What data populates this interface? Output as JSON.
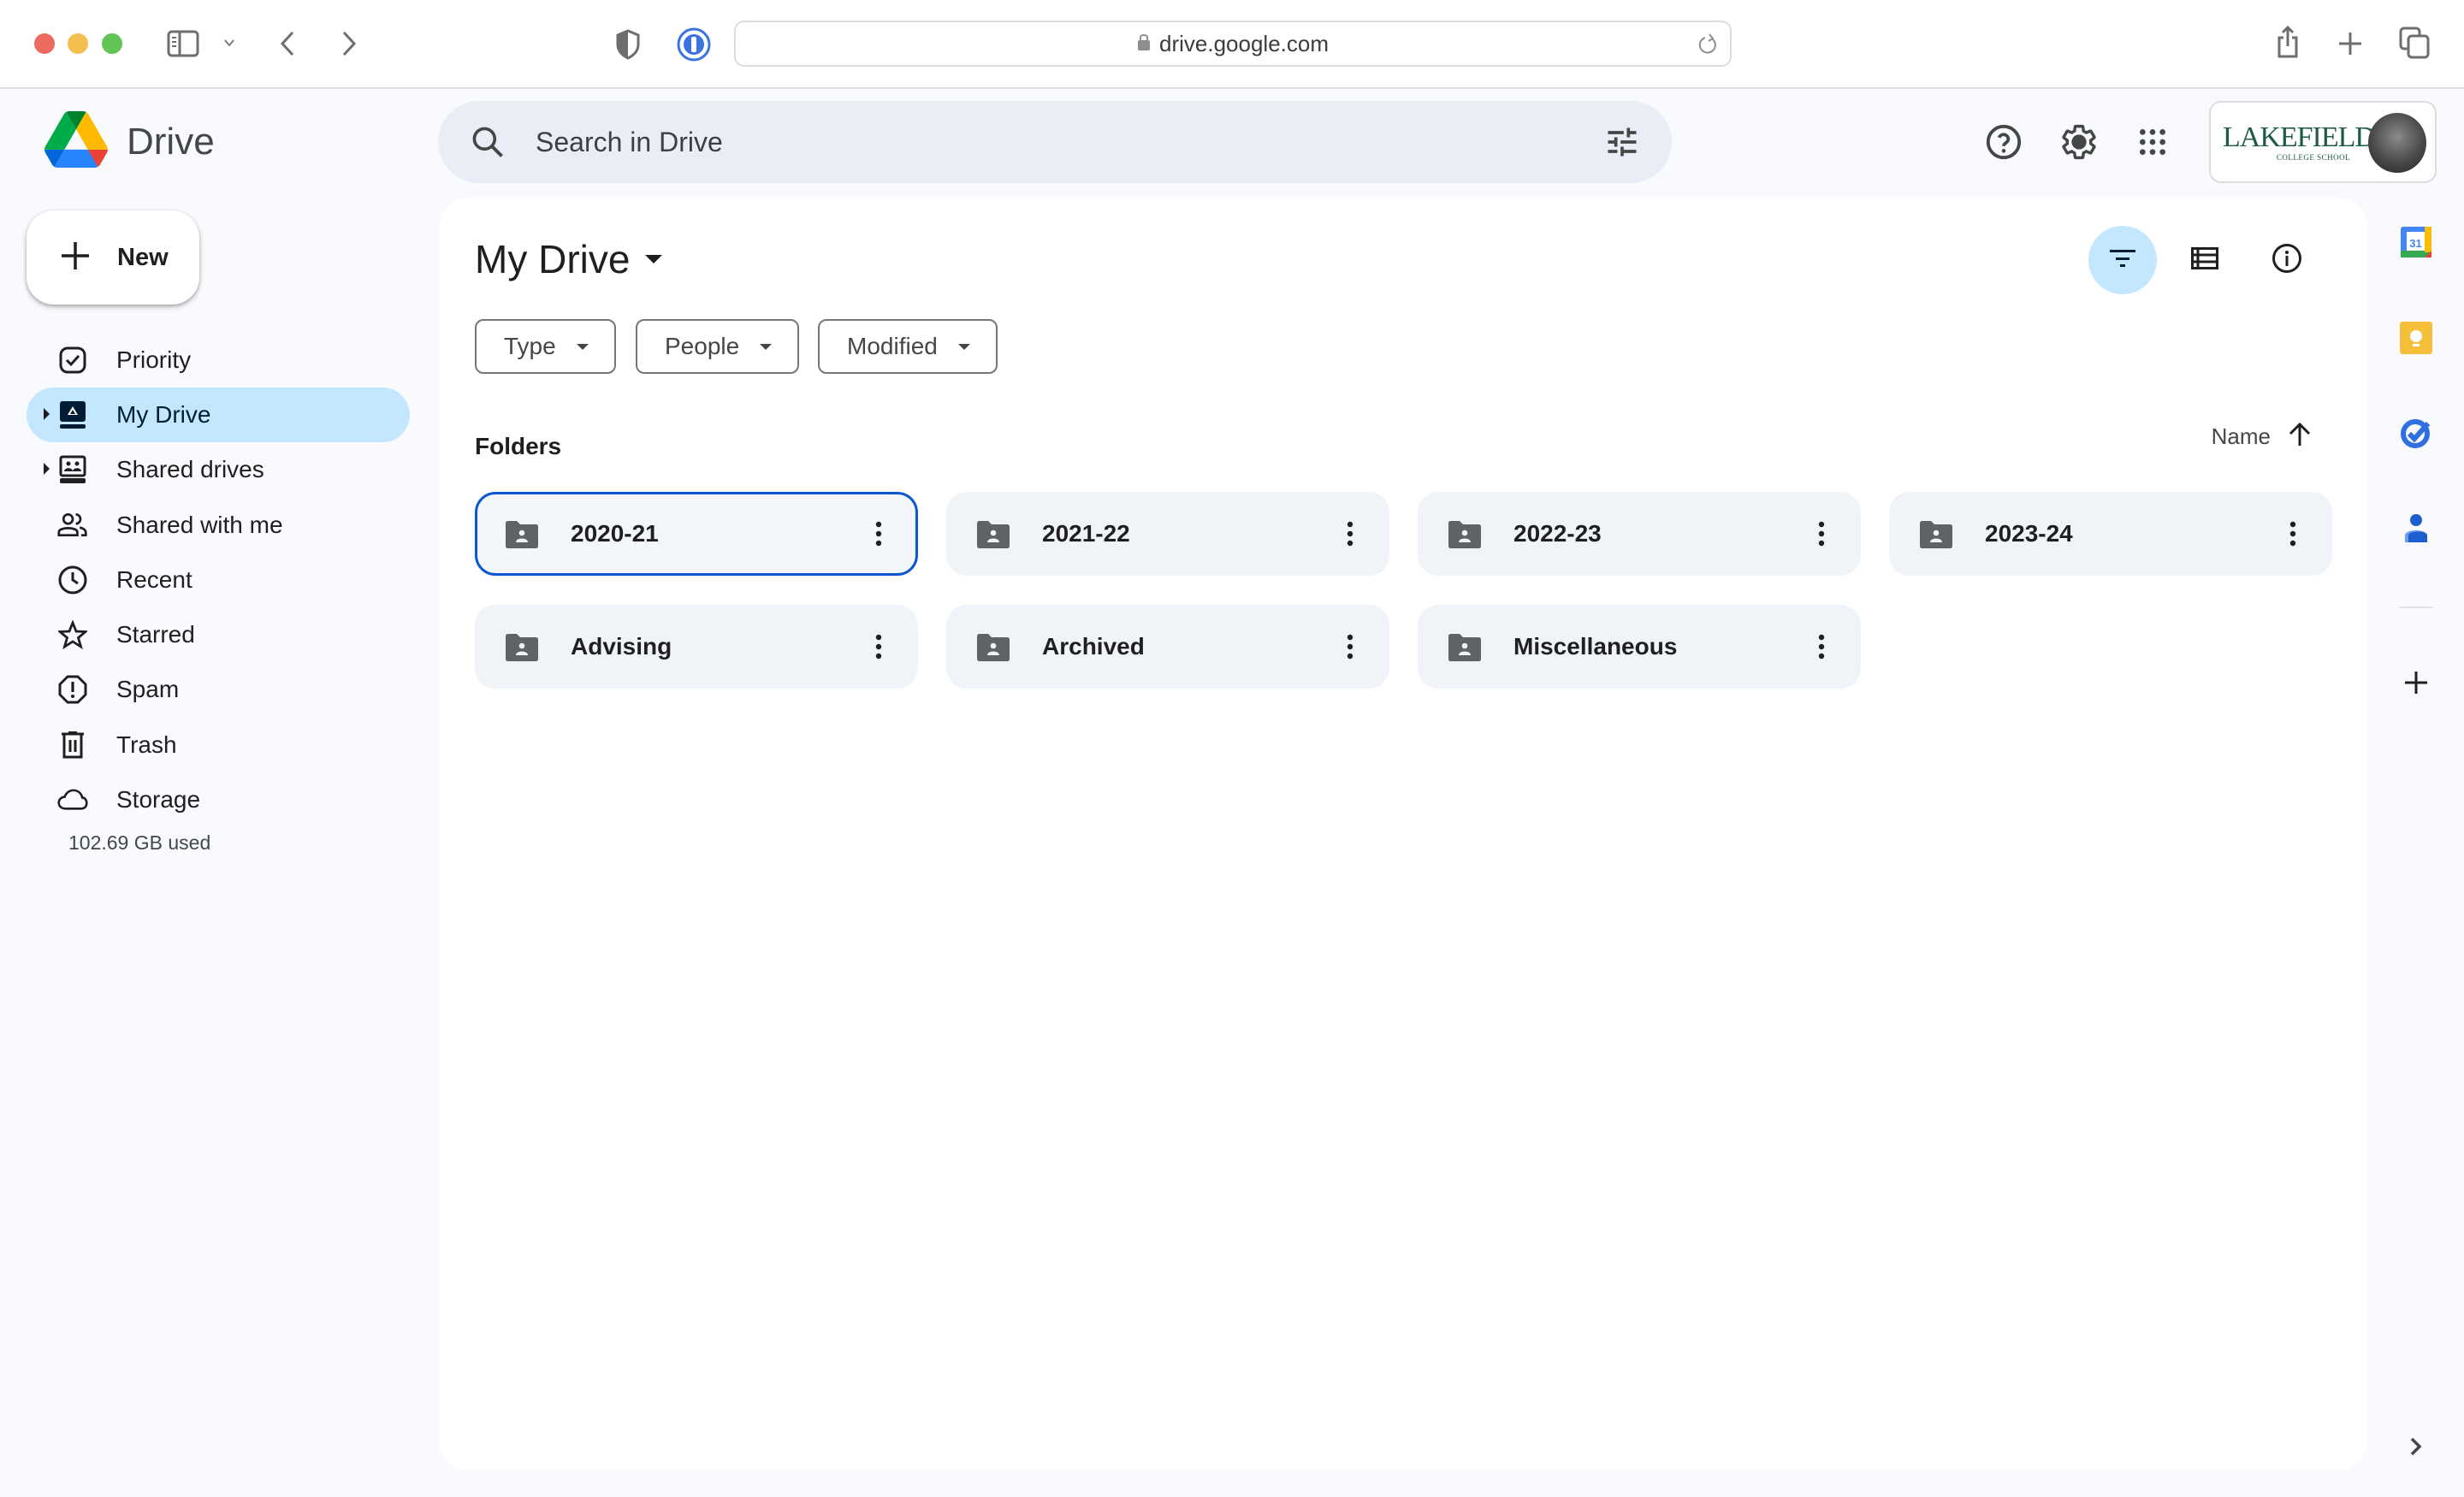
{
  "browser": {
    "url": "drive.google.com",
    "icons": [
      "sidebar-toggle-icon",
      "chevron-down-icon",
      "back-icon",
      "forward-icon",
      "shield-icon",
      "password-manager-icon",
      "lock-icon",
      "reload-icon",
      "share-icon",
      "new-tab-icon",
      "tab-overview-icon"
    ]
  },
  "app": {
    "name": "Drive",
    "search": {
      "placeholder": "Search in Drive",
      "value": ""
    },
    "header_icons": [
      "help-icon",
      "settings-icon",
      "apps-grid-icon"
    ],
    "account": {
      "org_name": "LAKEFIELD",
      "org_subtitle": "COLLEGE SCHOOL"
    }
  },
  "sidebar": {
    "new_label": "New",
    "items": [
      {
        "label": "Priority",
        "icon": "priority-check-icon",
        "expandable": false,
        "active": false
      },
      {
        "label": "My Drive",
        "icon": "my-drive-icon",
        "expandable": true,
        "active": true
      },
      {
        "label": "Shared drives",
        "icon": "shared-drives-icon",
        "expandable": true,
        "active": false
      },
      {
        "label": "Shared with me",
        "icon": "people-icon",
        "expandable": false,
        "active": false
      },
      {
        "label": "Recent",
        "icon": "clock-icon",
        "expandable": false,
        "active": false
      },
      {
        "label": "Starred",
        "icon": "star-icon",
        "expandable": false,
        "active": false
      },
      {
        "label": "Spam",
        "icon": "spam-icon",
        "expandable": false,
        "active": false
      },
      {
        "label": "Trash",
        "icon": "trash-icon",
        "expandable": false,
        "active": false
      },
      {
        "label": "Storage",
        "icon": "cloud-icon",
        "expandable": false,
        "active": false
      }
    ],
    "storage_used": "102.69 GB used"
  },
  "main": {
    "title": "My Drive",
    "view_buttons": [
      {
        "name": "filter-view",
        "active": true
      },
      {
        "name": "list-view",
        "active": false
      },
      {
        "name": "details",
        "active": false
      }
    ],
    "filters": [
      {
        "label": "Type"
      },
      {
        "label": "People"
      },
      {
        "label": "Modified"
      }
    ],
    "section_label": "Folders",
    "sort": {
      "label": "Name",
      "direction": "ascending"
    },
    "folders": [
      {
        "name": "2020-21",
        "selected": true
      },
      {
        "name": "2021-22",
        "selected": false
      },
      {
        "name": "2022-23",
        "selected": false
      },
      {
        "name": "2023-24",
        "selected": false
      },
      {
        "name": "Advising",
        "selected": false
      },
      {
        "name": "Archived",
        "selected": false
      },
      {
        "name": "Miscellaneous",
        "selected": false
      }
    ]
  },
  "right_rail": {
    "apps": [
      {
        "name": "Calendar",
        "calendar_day": "31"
      },
      {
        "name": "Keep"
      },
      {
        "name": "Tasks"
      },
      {
        "name": "Contacts"
      }
    ]
  },
  "colors": {
    "accent": "#0b57d0",
    "nav_active_bg": "#c2e7ff",
    "search_bg": "#e9eef6",
    "folder_bg": "#f0f4f9",
    "page_bg": "#f8fafd"
  }
}
